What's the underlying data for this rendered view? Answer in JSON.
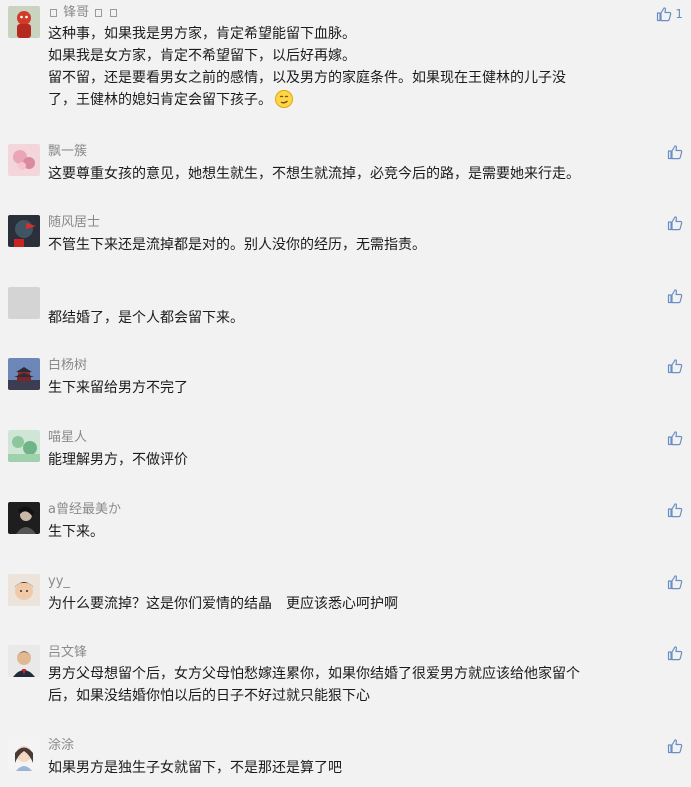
{
  "like_color": "#6b8ec4",
  "comments": [
    {
      "username": "锋哥",
      "avatar": "red-figure-avatar",
      "lines": [
        "这种事，如果我是男方家，肯定希望能留下血脉。",
        "如果我是女方家，肯定不希望留下，以后好再嫁。",
        "留不留，还是要看男女之前的感情，以及男方的家庭条件。如果现在王健林的儿子没",
        "了，王健林的媳妇肯定会留下孩子。"
      ],
      "emoji": "smirk-emoji",
      "like_count": "1"
    },
    {
      "username": "飘一簇",
      "avatar": "pink-flower-avatar",
      "lines": [
        "这要尊重女孩的意见，她想生就生，不想生就流掉，必竞今后的路，是需要她来行走。"
      ]
    },
    {
      "username": "随风居士",
      "avatar": "red-flag-avatar",
      "lines": [
        "不管生下来还是流掉都是对的。别人没你的经历，无需指责。"
      ]
    },
    {
      "username": "",
      "avatar": "default-gray-avatar",
      "lines": [
        "都结婚了，是个人都会留下来。"
      ]
    },
    {
      "username": "白杨树",
      "avatar": "temple-avatar",
      "lines": [
        "生下来留给男方不完了"
      ]
    },
    {
      "username": "喵星人",
      "avatar": "green-nature-avatar",
      "lines": [
        "能理解男方，不做评价"
      ]
    },
    {
      "username": "a曾经最美か",
      "avatar": "dark-portrait-avatar",
      "lines": [
        "生下来。"
      ]
    },
    {
      "username": "yy_",
      "avatar": "child-avatar",
      "lines": [
        "为什么要流掉？这是你们爱情的结晶　更应该悉心呵护啊"
      ]
    },
    {
      "username": "吕文锋",
      "avatar": "man-portrait-avatar",
      "lines": [
        "男方父母想留个后，女方父母怕愁嫁连累你，如果你结婚了很爱男方就应该给他家留个",
        "后，如果没结婚你怕以后的日子不好过就只能狠下心"
      ]
    },
    {
      "username": "涂涂",
      "avatar": "girl-cartoon-avatar",
      "lines": [
        "如果男方是独生子女就留下，不是那还是算了吧"
      ]
    }
  ]
}
